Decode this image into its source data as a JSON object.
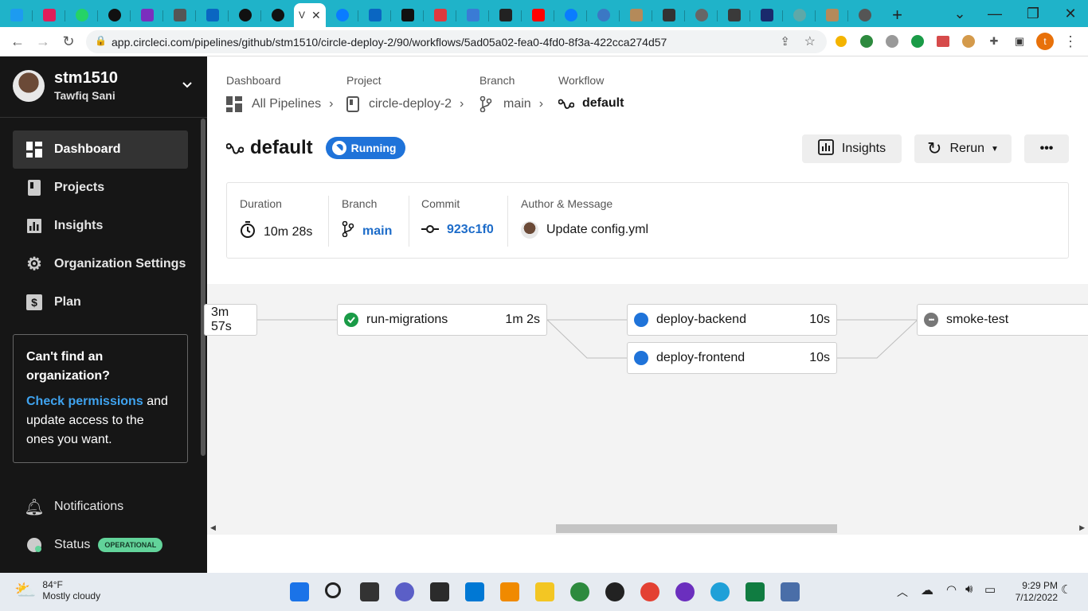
{
  "browser": {
    "url": "app.circleci.com/pipelines/github/stm1510/circle-deploy-2/90/workflows/5ad05a02-fea0-4fd0-8f3a-422cca274d57",
    "active_tab_title": "V"
  },
  "sidebar": {
    "user_name": "stm1510",
    "user_fullname": "Tawfiq Sani",
    "items": [
      {
        "label": "Dashboard"
      },
      {
        "label": "Projects"
      },
      {
        "label": "Insights"
      },
      {
        "label": "Organization Settings"
      },
      {
        "label": "Plan"
      }
    ],
    "box": {
      "title": "Can't find an organization?",
      "link": "Check permissions",
      "text": "and update access to the ones you want."
    },
    "notifications": "Notifications",
    "status_label": "Status",
    "status_badge": "OPERATIONAL"
  },
  "breadcrumb": {
    "dashboard": {
      "label": "Dashboard",
      "value": "All Pipelines"
    },
    "project": {
      "label": "Project",
      "value": "circle-deploy-2"
    },
    "branch": {
      "label": "Branch",
      "value": "main"
    },
    "workflow": {
      "label": "Workflow",
      "value": "default"
    }
  },
  "workflow": {
    "title": "default",
    "status": "Running",
    "insights_btn": "Insights",
    "rerun_btn": "Rerun",
    "more_btn": "•••"
  },
  "info": {
    "duration_label": "Duration",
    "duration": "10m 28s",
    "branch_label": "Branch",
    "branch": "main",
    "commit_label": "Commit",
    "commit": "923c1f0",
    "author_label": "Author & Message",
    "message": "Update config.yml"
  },
  "jobs": [
    {
      "name": "",
      "duration": "3m 57s",
      "status": "none"
    },
    {
      "name": "run-migrations",
      "duration": "1m 2s",
      "status": "success"
    },
    {
      "name": "deploy-backend",
      "duration": "10s",
      "status": "running"
    },
    {
      "name": "deploy-frontend",
      "duration": "10s",
      "status": "running"
    },
    {
      "name": "smoke-test",
      "duration": "",
      "status": "queued"
    }
  ],
  "taskbar": {
    "temp": "84°F",
    "weather": "Mostly cloudy",
    "time": "9:29 PM",
    "date": "7/12/2022"
  },
  "colors": {
    "accent_blue": "#1f73d9",
    "sidebar_bg": "#161616",
    "success": "#1a9b47",
    "operational": "#62d39a",
    "tabbar": "#1fb3c9"
  }
}
